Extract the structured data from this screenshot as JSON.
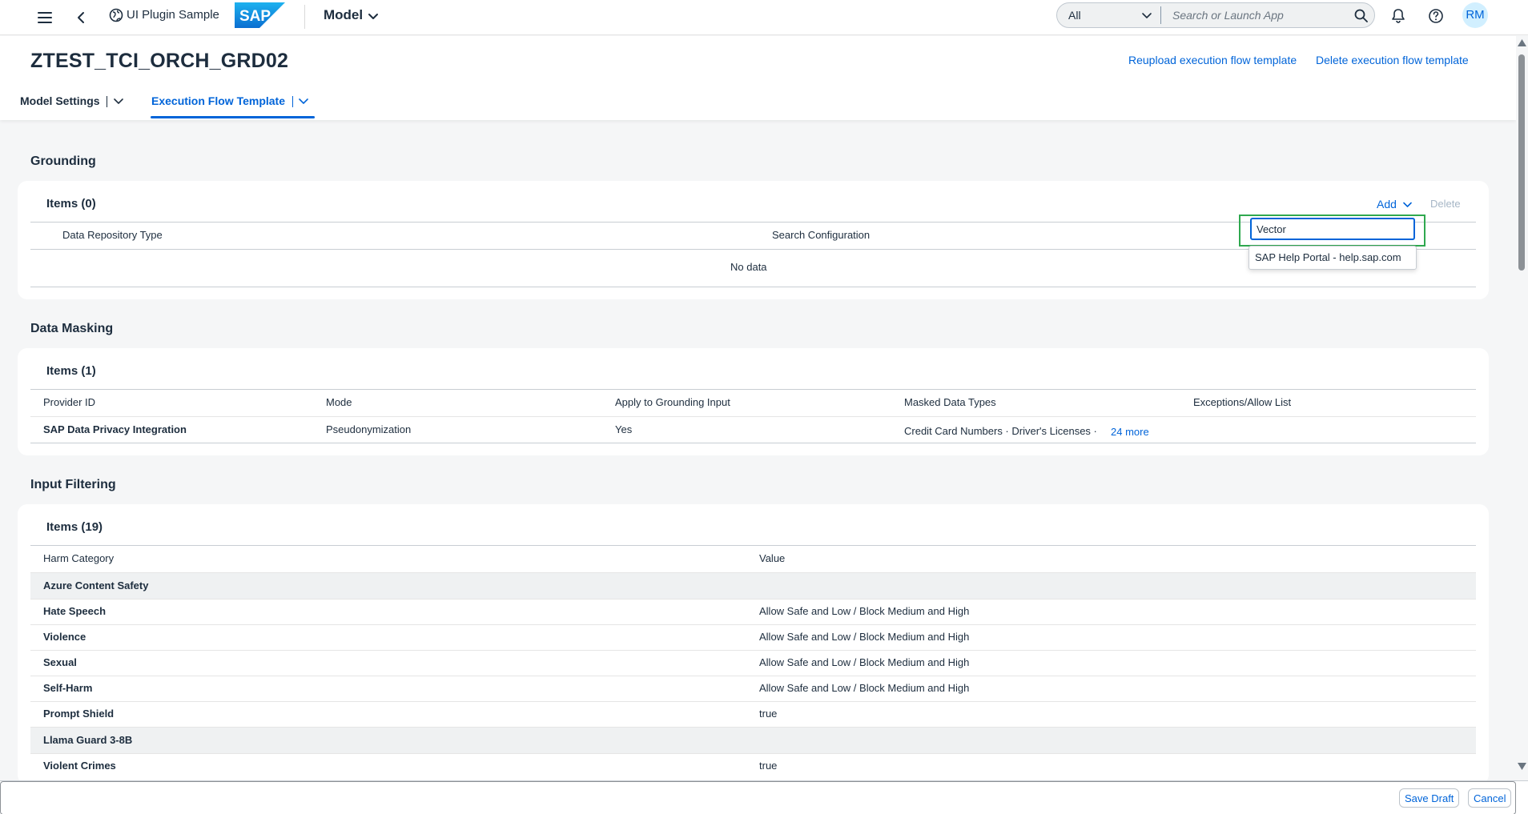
{
  "shell": {
    "app_name": "UI Plugin Sample",
    "title": "Model",
    "search_scope": "All",
    "search_placeholder": "Search or Launch App",
    "avatar_initials": "RM",
    "logo_text": "SAP"
  },
  "header": {
    "object_title": "ZTEST_TCI_ORCH_GRD02",
    "reupload_label": "Reupload execution flow template",
    "delete_label": "Delete execution flow template",
    "tabs": [
      {
        "label": "Model Settings",
        "selected": false
      },
      {
        "label": "Execution Flow Template",
        "selected": true
      }
    ]
  },
  "grounding": {
    "title": "Grounding",
    "items_title": "Items (0)",
    "add_label": "Add",
    "delete_label": "Delete",
    "columns": [
      "Data Repository Type",
      "Search Configuration"
    ],
    "no_data": "No data",
    "input_value": "Vector",
    "suggestion": "SAP Help Portal - help.sap.com"
  },
  "masking": {
    "title": "Data Masking",
    "items_title": "Items (1)",
    "columns": [
      "Provider ID",
      "Mode",
      "Apply to Grounding Input",
      "Masked Data Types",
      "Exceptions/Allow List"
    ],
    "row": {
      "provider": "SAP Data Privacy Integration",
      "mode": "Pseudonymization",
      "apply": "Yes",
      "types": "Credit Card Numbers · Driver's Licenses ·",
      "more": "24 more"
    }
  },
  "filtering": {
    "title": "Input Filtering",
    "items_title": "Items (19)",
    "columns": [
      "Harm Category",
      "Value"
    ],
    "rows": [
      {
        "category": "Azure Content Safety",
        "value": "",
        "group": true
      },
      {
        "category": "Hate Speech",
        "value": "Allow Safe and Low / Block Medium and High",
        "group": false
      },
      {
        "category": "Violence",
        "value": "Allow Safe and Low / Block Medium and High",
        "group": false
      },
      {
        "category": "Sexual",
        "value": "Allow Safe and Low / Block Medium and High",
        "group": false
      },
      {
        "category": "Self-Harm",
        "value": "Allow Safe and Low / Block Medium and High",
        "group": false
      },
      {
        "category": "Prompt Shield",
        "value": "true",
        "group": false
      },
      {
        "category": "Llama Guard 3-8B",
        "value": "",
        "group": true
      },
      {
        "category": "Violent Crimes",
        "value": "true",
        "group": false
      }
    ]
  },
  "footer": {
    "save_label": "Save Draft",
    "cancel_label": "Cancel"
  },
  "colors": {
    "accent": "#0064d9",
    "highlight": "#2fa84f",
    "text": "#1d2d3e"
  }
}
